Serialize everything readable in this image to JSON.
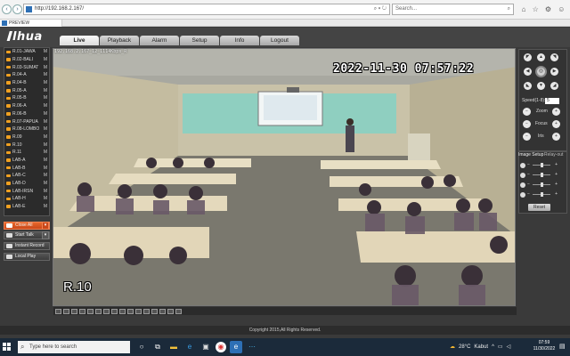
{
  "browser": {
    "back_icon": "back-arrow-icon",
    "forward_icon": "forward-arrow-icon",
    "address": "http://192.168.2.167/",
    "search_placeholder": "Search...",
    "tab_title": "PREVIEW"
  },
  "app": {
    "logo": "alhua",
    "menu": [
      "Live",
      "Playback",
      "Alarm",
      "Setup",
      "Info",
      "Logout"
    ],
    "active_menu": "Live"
  },
  "channels": [
    {
      "label": "R.01-JAWA",
      "mark": "M"
    },
    {
      "label": "R.02-BALI",
      "mark": "M"
    },
    {
      "label": "R.03-SUMAT",
      "mark": "M"
    },
    {
      "label": "R.04-A",
      "mark": "M"
    },
    {
      "label": "R.04-B",
      "mark": "M"
    },
    {
      "label": "R.05-A",
      "mark": "M"
    },
    {
      "label": "R.05-B",
      "mark": "M"
    },
    {
      "label": "R.06-A",
      "mark": "M"
    },
    {
      "label": "R.06-B",
      "mark": "M"
    },
    {
      "label": "R.07-PAPUA",
      "mark": "M"
    },
    {
      "label": "R.08-LOMBO",
      "mark": "M"
    },
    {
      "label": "R.09",
      "mark": "M"
    },
    {
      "label": "R.10",
      "mark": "M"
    },
    {
      "label": "R.11",
      "mark": "M"
    },
    {
      "label": "LAB-A",
      "mark": "M"
    },
    {
      "label": "LAB-B",
      "mark": "M"
    },
    {
      "label": "LAB-C",
      "mark": "M"
    },
    {
      "label": "LAB-D",
      "mark": "M"
    },
    {
      "label": "LAB-IRSN",
      "mark": "M"
    },
    {
      "label": "LAB-H",
      "mark": "M"
    },
    {
      "label": "LAB-E",
      "mark": "M"
    }
  ],
  "controls": {
    "close_all": "Close All",
    "start_talk": "Start Talk",
    "instant_record": "Instant Record",
    "local_play": "Local Play"
  },
  "video": {
    "info": "192.168.2.167_12_1114Kbps_R",
    "timestamp": "2022-11-30  07:57:22",
    "room_label": "R.10"
  },
  "ptz": {
    "speed_label": "Speed(1-8):",
    "speed_value": "5",
    "zoom_label": "Zoom",
    "focus_label": "Focus",
    "iris_label": "Iris"
  },
  "image_setup": {
    "tab_image": "Image Setup",
    "tab_relay": "Relay-out",
    "reset_label": "Reset",
    "slider_levels": [
      0.45,
      0.45,
      0.45,
      0.45
    ]
  },
  "footer": {
    "copyright": "Copyright 2015,All Rights Reserved."
  },
  "taskbar": {
    "search_placeholder": "Type here to search",
    "weather_temp": "28°C",
    "weather_desc": "Kabut",
    "time": "07:59",
    "date": "11/30/2022"
  },
  "colors": {
    "accent_orange": "#e8682b",
    "camera_icon": "#f0a020",
    "taskbar": "#1b2a3a"
  }
}
